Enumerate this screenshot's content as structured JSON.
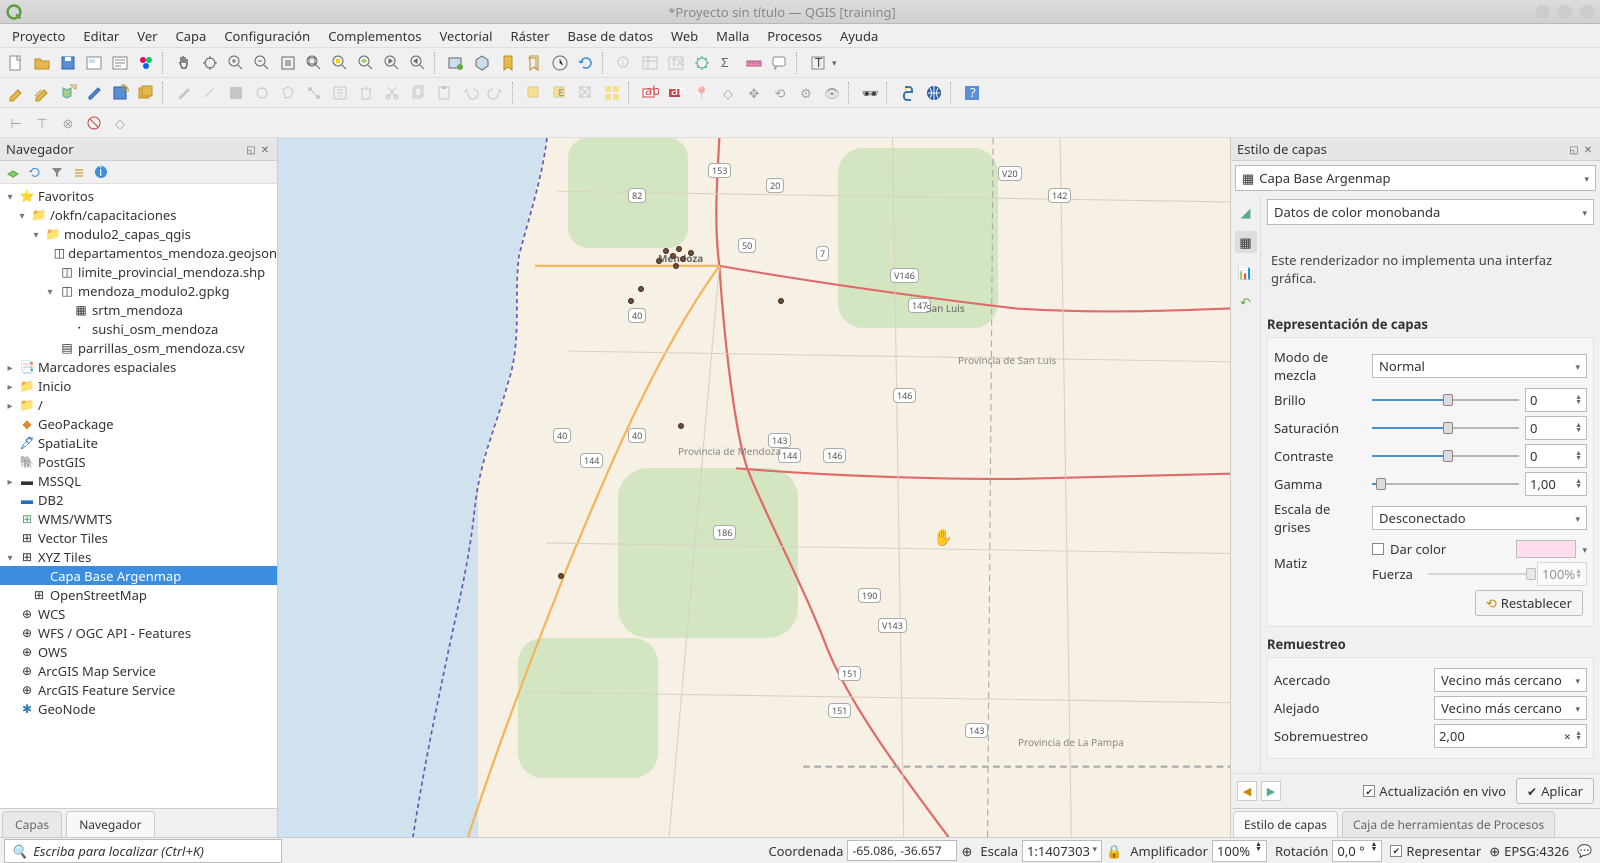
{
  "window": {
    "title": "*Proyecto sin título — QGIS [training]"
  },
  "menubar": [
    "Proyecto",
    "Editar",
    "Ver",
    "Capa",
    "Configuración",
    "Complementos",
    "Vectorial",
    "Ráster",
    "Base de datos",
    "Web",
    "Malla",
    "Procesos",
    "Ayuda"
  ],
  "browser": {
    "title": "Navegador",
    "toolbar_icons": [
      "add-icon",
      "refresh-icon",
      "filter-icon",
      "collapse-icon",
      "info-icon"
    ],
    "tree": [
      {
        "label": "Favoritos",
        "indent": 0,
        "toggle": "▾",
        "icon": "⭐",
        "color": "#e8a400"
      },
      {
        "label": "/okfn/capacitaciones",
        "indent": 1,
        "toggle": "▾",
        "icon": "📁"
      },
      {
        "label": "modulo2_capas_qgis",
        "indent": 2,
        "toggle": "▾",
        "icon": "📁"
      },
      {
        "label": "departamentos_mendoza.geojson",
        "indent": 3,
        "toggle": "",
        "icon": "◫"
      },
      {
        "label": "limite_provincial_mendoza.shp",
        "indent": 3,
        "toggle": "",
        "icon": "◫"
      },
      {
        "label": "mendoza_modulo2.gpkg",
        "indent": 3,
        "toggle": "▾",
        "icon": "◫"
      },
      {
        "label": "srtm_mendoza",
        "indent": 4,
        "toggle": "",
        "icon": "▦"
      },
      {
        "label": "sushi_osm_mendoza",
        "indent": 4,
        "toggle": "",
        "icon": "⠂"
      },
      {
        "label": "parrillas_osm_mendoza.csv",
        "indent": 3,
        "toggle": "",
        "icon": "▤"
      },
      {
        "label": "Marcadores espaciales",
        "indent": 0,
        "toggle": "▸",
        "icon": "📑"
      },
      {
        "label": "Inicio",
        "indent": 0,
        "toggle": "▸",
        "icon": "📁"
      },
      {
        "label": "/",
        "indent": 0,
        "toggle": "▸",
        "icon": "📁"
      },
      {
        "label": "GeoPackage",
        "indent": 0,
        "toggle": "",
        "icon": "◆",
        "color": "#d98c2b"
      },
      {
        "label": "SpatiaLite",
        "indent": 0,
        "toggle": "",
        "icon": "🖋",
        "color": "#1560bd"
      },
      {
        "label": "PostGIS",
        "indent": 0,
        "toggle": "",
        "icon": "🐘",
        "color": "#336791"
      },
      {
        "label": "MSSQL",
        "indent": 0,
        "toggle": "▸",
        "icon": "▬"
      },
      {
        "label": "DB2",
        "indent": 0,
        "toggle": "",
        "icon": "▬",
        "color": "#1f70c1"
      },
      {
        "label": "WMS/WMTS",
        "indent": 0,
        "toggle": "",
        "icon": "⊞",
        "color": "#5a9e6f"
      },
      {
        "label": "Vector Tiles",
        "indent": 0,
        "toggle": "",
        "icon": "⊞"
      },
      {
        "label": "XYZ Tiles",
        "indent": 0,
        "toggle": "▾",
        "icon": "⊞"
      },
      {
        "label": "Capa Base Argenmap",
        "indent": 1,
        "toggle": "",
        "icon": "",
        "selected": true
      },
      {
        "label": "OpenStreetMap",
        "indent": 1,
        "toggle": "",
        "icon": "⊞"
      },
      {
        "label": "WCS",
        "indent": 0,
        "toggle": "",
        "icon": "⊕"
      },
      {
        "label": "WFS / OGC API - Features",
        "indent": 0,
        "toggle": "",
        "icon": "⊕"
      },
      {
        "label": "OWS",
        "indent": 0,
        "toggle": "",
        "icon": "⊕"
      },
      {
        "label": "ArcGIS Map Service",
        "indent": 0,
        "toggle": "",
        "icon": "⊕"
      },
      {
        "label": "ArcGIS Feature Service",
        "indent": 0,
        "toggle": "",
        "icon": "⊕"
      },
      {
        "label": "GeoNode",
        "indent": 0,
        "toggle": "",
        "icon": "✱",
        "color": "#2c7fb8"
      }
    ]
  },
  "left_tabs": {
    "active": "Navegador",
    "inactive": "Capas"
  },
  "style_panel": {
    "title": "Estilo de capas",
    "layer_name": "Capa Base Argenmap",
    "renderer": "Datos de color monobanda",
    "note": "Este renderizador no implementa una interfaz gráfica.",
    "section_rendering": "Representación de capas",
    "blend_label": "Modo de mezcla",
    "blend_value": "Normal",
    "brightness_label": "Brillo",
    "brightness_value": "0",
    "saturation_label": "Saturación",
    "saturation_value": "0",
    "contrast_label": "Contraste",
    "contrast_value": "0",
    "gamma_label": "Gamma",
    "gamma_value": "1,00",
    "grayscale_label": "Escala de grises",
    "grayscale_value": "Desconectado",
    "hue_label": "Matiz",
    "colorize_label": "Dar color",
    "strength_label": "Fuerza",
    "strength_value": "100%",
    "reset_label": "Restablecer",
    "section_resampling": "Remuestreo",
    "zoomin_label": "Acercado",
    "zoomin_value": "Vecino más cercano",
    "zoomout_label": "Alejado",
    "zoomout_value": "Vecino más cercano",
    "oversampling_label": "Sobremuestreo",
    "oversampling_value": "2,00",
    "live_update_label": "Actualización en vivo",
    "apply_label": "Aplicar"
  },
  "right_tabs": {
    "active": "Estilo de capas",
    "inactive": "Caja de herramientas de Procesos"
  },
  "statusbar": {
    "locator_placeholder": "Escriba para localizar (Ctrl+K)",
    "coord_label": "Coordenada",
    "coord_value": "-65.086, -36.657",
    "scale_label": "Escala",
    "scale_value": "1:1407303",
    "magnifier_label": "Amplificador",
    "magnifier_value": "100%",
    "rotation_label": "Rotación",
    "rotation_value": "0,0 °",
    "render_label": "Representar",
    "crs": "EPSG:4326"
  },
  "map_labels": {
    "mendoza": "Mendoza",
    "sanluis": "San Luis",
    "prov_sanluis": "Provincia de San Luis",
    "prov_mendoza": "Provincia de Mendoza",
    "prov_lapampa": "Provincia de La Pampa"
  }
}
